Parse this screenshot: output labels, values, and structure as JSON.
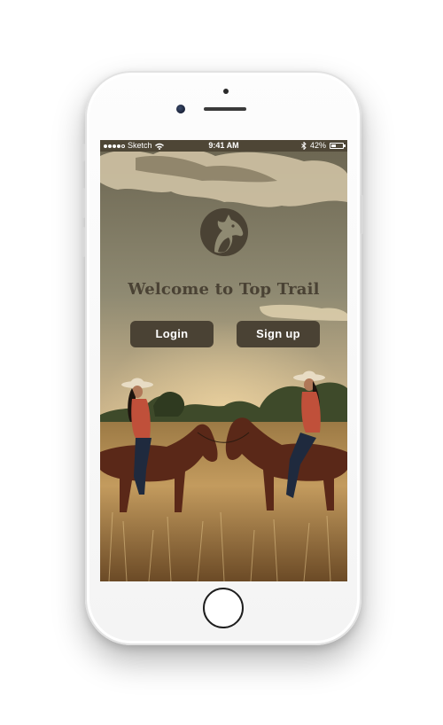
{
  "status_bar": {
    "carrier": "Sketch",
    "time": "9:41 AM",
    "battery_percent": "42%",
    "battery_level": 0.42,
    "icons": [
      "signal-dots-icon",
      "wifi-icon",
      "bluetooth-icon",
      "battery-icon"
    ]
  },
  "app": {
    "logo_icon": "horse-head-icon",
    "welcome_text": "Welcome to Top Trail",
    "login_label": "Login",
    "signup_label": "Sign up"
  },
  "colors": {
    "accent": "#4a4234",
    "button_text": "#ffffff",
    "status_bar_bg": "#4e4636"
  }
}
